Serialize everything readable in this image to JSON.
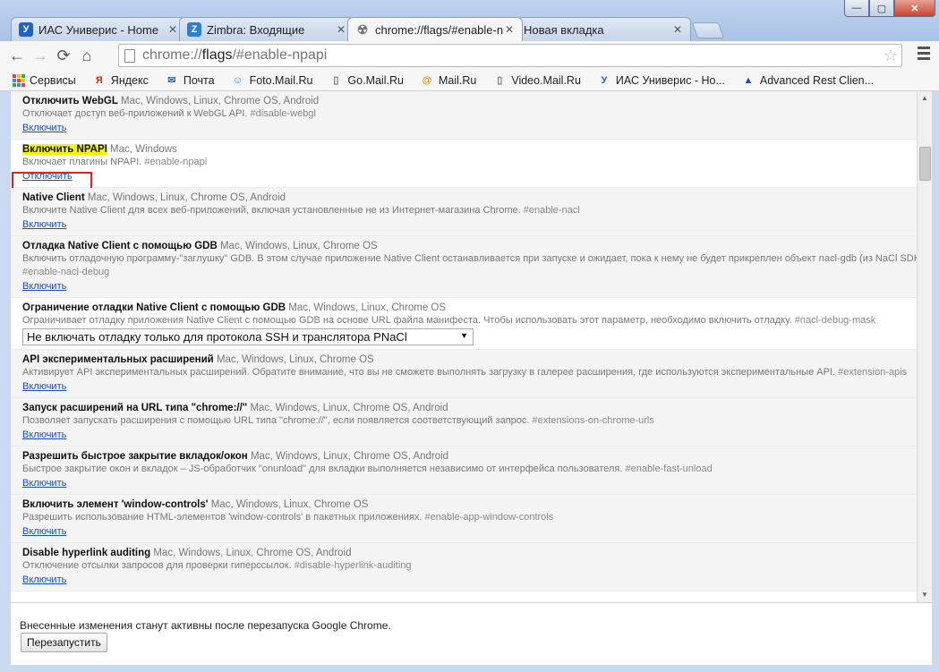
{
  "window": {
    "buttons": {
      "minimize": "—",
      "maximize": "▢",
      "close": "✕"
    }
  },
  "tabs": [
    {
      "title": "ИАС Универис - Home",
      "icon": "universis-icon",
      "icon_glyph": "У",
      "icon_color": "#1f62c8",
      "active": false
    },
    {
      "title": "Zimbra: Входящие",
      "icon": "zimbra-icon",
      "icon_glyph": "Z",
      "icon_color": "#2f7fd1",
      "active": false
    },
    {
      "title": "chrome://flags/#enable-n",
      "icon": "radiation-icon",
      "icon_glyph": "☢",
      "icon_color": "#777777",
      "active": true
    },
    {
      "title": "Новая вкладка",
      "icon": "",
      "icon_glyph": "",
      "icon_color": "",
      "active": false
    }
  ],
  "toolbar": {
    "back": "←",
    "forward": "→",
    "reload": "⟳",
    "home": "⌂",
    "url_scheme": "chrome://",
    "url_host": "flags",
    "url_rest": "/#enable-npapi",
    "star": "☆"
  },
  "bookmarks": [
    {
      "label": "Сервисы",
      "icon": "apps-icon"
    },
    {
      "label": "Яндекс",
      "icon": "yandex-icon",
      "glyph": "Я",
      "color": "#e0251b"
    },
    {
      "label": "Почта",
      "icon": "mail-icon",
      "glyph": "✉",
      "color": "#2a66b3"
    },
    {
      "label": "Foto.Mail.Ru",
      "icon": "foto-mail-icon",
      "glyph": "☺",
      "color": "#1a8fd8"
    },
    {
      "label": "Go.Mail.Ru",
      "icon": "page-icon",
      "glyph": "▯",
      "color": "#777777"
    },
    {
      "label": "Mail.Ru",
      "icon": "mailru-at-icon",
      "glyph": "@",
      "color": "#f08a00"
    },
    {
      "label": "Video.Mail.Ru",
      "icon": "page-icon",
      "glyph": "▯",
      "color": "#777777"
    },
    {
      "label": "ИАС Универис - Но...",
      "icon": "universis-icon",
      "glyph": "У",
      "color": "#1f62c8"
    },
    {
      "label": "Advanced Rest Clien...",
      "icon": "rest-client-icon",
      "glyph": "▲",
      "color": "#1e4fa8"
    }
  ],
  "experiments": [
    {
      "name": "Отключить WebGL",
      "platforms": "Mac, Windows, Linux, Chrome OS, Android",
      "desc": "Отключает доступ веб-приложений к WebGL API.",
      "link": "#disable-webgl",
      "action": "Включить",
      "enabled": false,
      "highlight": false
    },
    {
      "name": "Включить NPAPI",
      "platforms": "Mac, Windows",
      "desc": "Включает плагины NPAPI.",
      "link": "#enable-npapi",
      "action": "Отключить",
      "enabled": true,
      "highlight": true
    },
    {
      "name": "Native Client",
      "platforms": "Mac, Windows, Linux, Chrome OS, Android",
      "desc": "Включите Native Client для всех веб-приложений, включая установленные не из Интернет-магазина Chrome.",
      "link": "#enable-nacl",
      "action": "Включить",
      "enabled": false,
      "highlight": false
    },
    {
      "name": "Отладка Native Client с помощью GDB",
      "platforms": "Mac, Windows, Linux, Chrome OS",
      "desc": "Включить отладочную программу-\"заглушку\" GDB. В этом случае приложение Native Client останавливается при запуске и ожидает, пока к нему не будет прикреплен объект nacl-gdb (из NaCl SDK).",
      "link": "#enable-nacl-debug",
      "link_newline": true,
      "action": "Включить",
      "enabled": false,
      "highlight": false
    },
    {
      "name": "Ограничение отладки Native Client с помощью GDB",
      "platforms": "Mac, Windows, Linux, Chrome OS",
      "desc": "Ограничивает отладку приложения Native Client с помощью GDB на основе URL файла манифеста. Чтобы использовать этот параметр, необходимо включить отладку.",
      "link": "#nacl-debug-mask",
      "select": "Не включать отладку только для протокола SSH и транслятора PNaCl",
      "action": "",
      "enabled": true,
      "highlight": false
    },
    {
      "name": "API экспериментальных расширений",
      "platforms": "Mac, Windows, Linux, Chrome OS",
      "desc": "Активирует API экспериментальных расширений. Обратите внимание, что вы не сможете выполнять загрузку в галерее расширения, где используются экспериментальные API.",
      "link": "#extension-apis",
      "action": "Включить",
      "enabled": false,
      "highlight": false
    },
    {
      "name": "Запуск расширений на URL типа \"chrome://\"",
      "platforms": "Mac, Windows, Linux, Chrome OS, Android",
      "desc": "Позволяет запускать расширения с помощью URL типа \"chrome://\", если появляется соответствующий запрос.",
      "link": "#extensions-on-chrome-urls",
      "action": "Включить",
      "enabled": false,
      "highlight": false
    },
    {
      "name": "Разрешить быстрое закрытие вкладок/окон",
      "platforms": "Mac, Windows, Linux, Chrome OS, Android",
      "desc": "Быстрое закрытие окон и вкладок – JS-обработчик \"onunload\" для вкладки выполняется независимо от интерфейса пользователя.",
      "link": "#enable-fast-unload",
      "action": "Включить",
      "enabled": false,
      "highlight": false
    },
    {
      "name": "Включить элемент 'window-controls'",
      "platforms": "Mac, Windows, Linux, Chrome OS",
      "desc": "Разрешить использование HTML-элементов 'window-controls' в пакетных приложениях.",
      "link": "#enable-app-window-controls",
      "action": "Включить",
      "enabled": false,
      "highlight": false
    },
    {
      "name": "Disable hyperlink auditing",
      "platforms": "Mac, Windows, Linux, Chrome OS, Android",
      "desc": "Отключение отсылки запросов для проверки гиперссылок.",
      "link": "#disable-hyperlink-auditing",
      "action": "Включить",
      "enabled": false,
      "highlight": false
    }
  ],
  "footer": {
    "message": "Внесенные изменения станут активны после перезапуска Google Chrome.",
    "relaunch_label": "Перезапустить"
  },
  "colors": {
    "highlight": "#f6f600",
    "annotation_box": "#d4262a",
    "link": "#1a4ec2"
  }
}
